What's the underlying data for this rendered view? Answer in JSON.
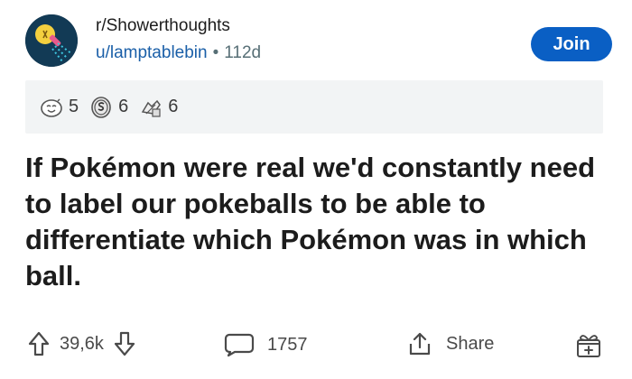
{
  "post": {
    "subreddit": "r/Showerthoughts",
    "username": "u/lamptablebin",
    "age": "112d",
    "join_label": "Join",
    "awards": [
      {
        "icon": "laughing-face-award-icon",
        "count": "5"
      },
      {
        "icon": "silver-coin-award-icon",
        "count": "6"
      },
      {
        "icon": "helpful-hands-award-icon",
        "count": "6"
      }
    ],
    "title": "If Pokémon were real we'd constantly need to label our pokeballs to be able to differentiate which Pokémon was in which ball."
  },
  "actions": {
    "votes": "39,6k",
    "comments": "1757",
    "share_label": "Share"
  }
}
